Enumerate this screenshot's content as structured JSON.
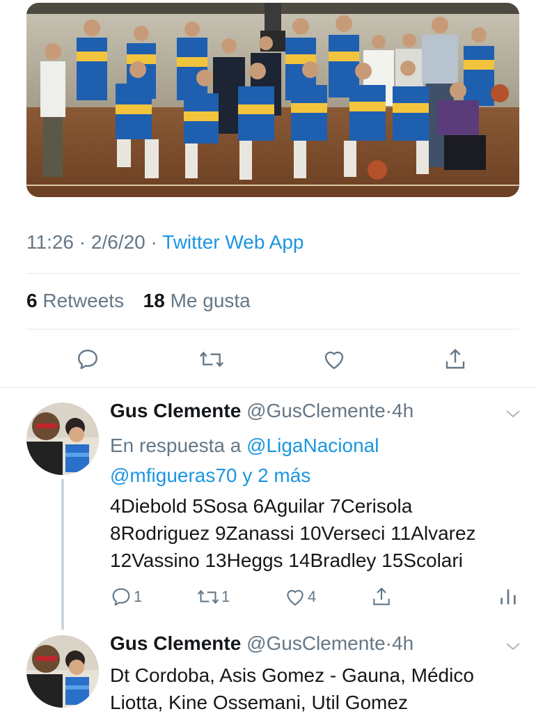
{
  "main_tweet": {
    "time": "11:26",
    "date": "2/6/20",
    "source": "Twitter Web App",
    "retweets_count": "6",
    "retweets_label": "Retweets",
    "likes_count": "18",
    "likes_label": "Me gusta",
    "actions": {
      "reply_icon": "speech-bubble-icon",
      "retweet_icon": "retweet-arrows-icon",
      "like_icon": "heart-outline-icon",
      "share_icon": "share-upload-icon"
    }
  },
  "replies": [
    {
      "name": "Gus Clemente",
      "handle": "@GusClemente",
      "separator": "·",
      "age": "4h",
      "reply_prefix": "En respuesta a",
      "reply_to_1": "@LigaNacional",
      "reply_to_2": "@mfigueras70",
      "reply_suffix": "y 2 más",
      "text_line_1": "4Diebold 5Sosa 6Aguilar 7Cerisola",
      "text_line_2": "8Rodriguez 9Zanassi 10Verseci 11Alvarez",
      "text_line_3": "12Vassino 13Heggs 14Bradley 15Scolari",
      "reply_count": "1",
      "retweet_count": "1",
      "like_count": "4"
    },
    {
      "name": "Gus Clemente",
      "handle": "@GusClemente",
      "separator": "·",
      "age": "4h",
      "text_line_1": "Dt Cordoba, Asis Gomez - Gauna, Médico",
      "text_line_2": "Liotta, Kine Ossemani, Util Gomez"
    }
  ],
  "colors": {
    "link_blue": "#1b95e0",
    "secondary_gray": "#657786",
    "divider": "#e1e8ed",
    "jersey_blue": "#1f6fc4",
    "jersey_yellow": "#f2c43d"
  }
}
